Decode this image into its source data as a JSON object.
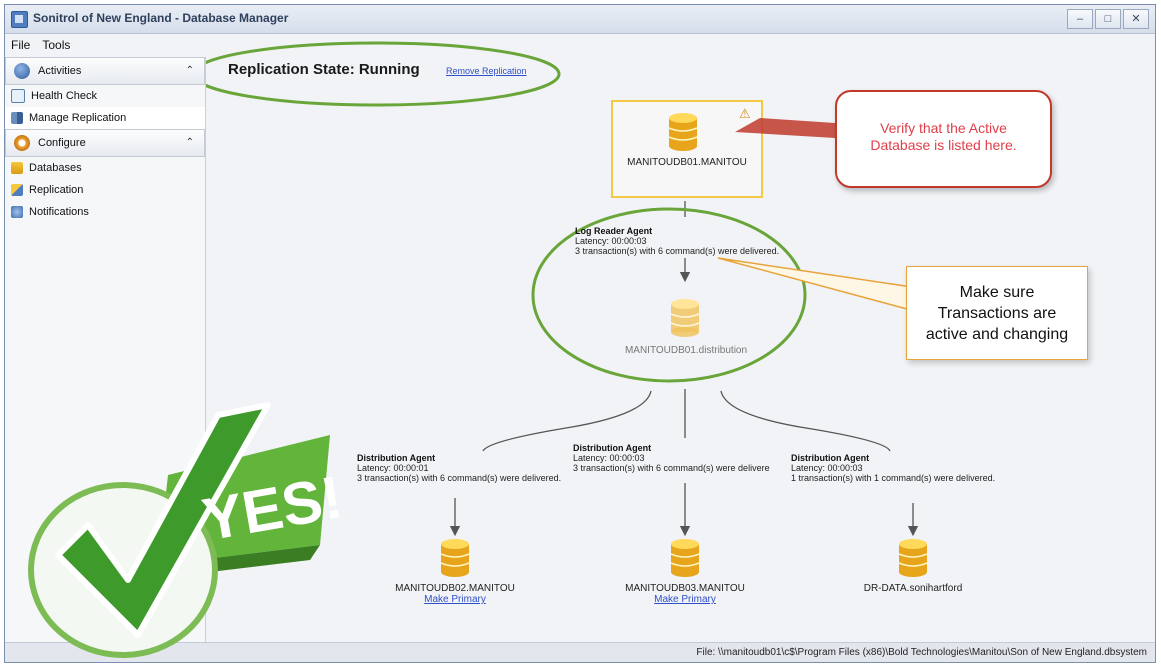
{
  "window": {
    "title": "Sonitrol of New England - Database Manager",
    "buttons": [
      "–",
      "□",
      "✕"
    ]
  },
  "menu": {
    "file": "File",
    "tools": "Tools"
  },
  "sidebar": {
    "activities": "Activities",
    "health_check": "Health Check",
    "manage_replication": "Manage Replication",
    "configure": "Configure",
    "databases": "Databases",
    "replication": "Replication",
    "notifications": "Notifications"
  },
  "main": {
    "replication_state": "Replication State: Running",
    "remove_replication": "Remove Replication",
    "publisher": {
      "name": "MANITOUDB01.MANITOU"
    },
    "log_reader": {
      "title": "Log Reader Agent",
      "latency": "Latency: 00:00:03",
      "transactions": "3 transaction(s) with 6 command(s) were delivered."
    },
    "distributor": {
      "name": "MANITOUDB01.distribution"
    },
    "distribution_agents": [
      {
        "title": "Distribution Agent",
        "latency": "Latency: 00:00:01",
        "transactions": "3 transaction(s) with 6 command(s) were delivered."
      },
      {
        "title": "Distribution Agent",
        "latency": "Latency: 00:00:03",
        "transactions": "3 transaction(s) with 6 command(s) were delivere"
      },
      {
        "title": "Distribution Agent",
        "latency": "Latency: 00:00:03",
        "transactions": "1 transaction(s) with 1 command(s) were delivered."
      }
    ],
    "subscribers": [
      {
        "name": "MANITOUDB02.MANITOU",
        "action": "Make Primary"
      },
      {
        "name": "MANITOUDB03.MANITOU",
        "action": "Make Primary"
      },
      {
        "name": "DR-DATA.sonihartford",
        "action": ""
      }
    ]
  },
  "callouts": {
    "verify": {
      "line1": "Verify that the Active",
      "line2": "Database is listed here."
    },
    "make_sure": {
      "line1": "Make sure",
      "line2": "Transactions are",
      "line3": "active and changing"
    }
  },
  "badge": {
    "text": "YES!"
  },
  "status": {
    "file_path": "File: \\\\manitoudb01\\c$\\Program Files (x86)\\Bold Technologies\\Manitou\\Son of New England.dbsystem"
  },
  "colors": {
    "ellipse_green": "#6aa53a",
    "publisher_border": "#f2c945",
    "verify_callout_border": "#c0392b",
    "verify_callout_text": "#e0404a",
    "make_sure_border": "#e8a33b",
    "link": "#3050c8",
    "checkmark_green": "#3f9a2c",
    "yes_flag": "#62b43a"
  }
}
